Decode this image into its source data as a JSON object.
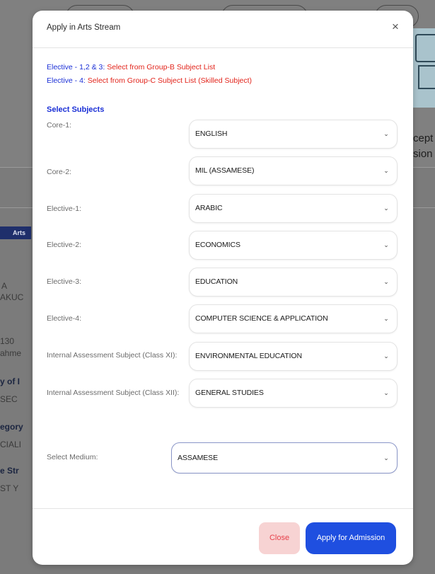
{
  "background": {
    "left_fragments": [
      "Arts S",
      "A",
      "AKUC",
      "130",
      "ahme",
      "y of I",
      "SEC",
      "egory",
      "CIALI",
      "e Str",
      "ST Y"
    ],
    "right_fragments": [
      "cept",
      "sion"
    ]
  },
  "modal": {
    "title": "Apply in Arts Stream",
    "close_symbol": "×",
    "notes": [
      {
        "highlight": "Elective - 1,2 & 3:",
        "text": " Select from Group-B Subject List"
      },
      {
        "highlight": "Elective - 4:",
        "text": " Select from Group-C Subject List (Skilled Subject)"
      }
    ],
    "section_title": "Select Subjects",
    "fields": [
      {
        "label": "Core-1:",
        "value": "ENGLISH"
      },
      {
        "label": "Core-2:",
        "value": "MIL (ASSAMESE)"
      },
      {
        "label": "Elective-1:",
        "value": "ARABIC"
      },
      {
        "label": "Elective-2:",
        "value": "ECONOMICS"
      },
      {
        "label": "Elective-3:",
        "value": "EDUCATION"
      },
      {
        "label": "Elective-4:",
        "value": "COMPUTER SCIENCE & APPLICATION"
      },
      {
        "label": "Internal Assessment Subject (Class XI):",
        "value": "ENVIRONMENTAL EDUCATION"
      },
      {
        "label": "Internal Assessment Subject (Class XII):",
        "value": "GENERAL STUDIES"
      }
    ],
    "medium": {
      "label": "Select Medium:",
      "value": "ASSAMESE"
    },
    "chevron": "⌄",
    "buttons": {
      "close": "Close",
      "apply": "Apply for Admission"
    }
  },
  "colors": {
    "accent_blue": "#1a2fd6",
    "note_red": "#e2231a",
    "apply_button": "#1f4fe0",
    "close_button_bg": "#f7d3d3"
  }
}
